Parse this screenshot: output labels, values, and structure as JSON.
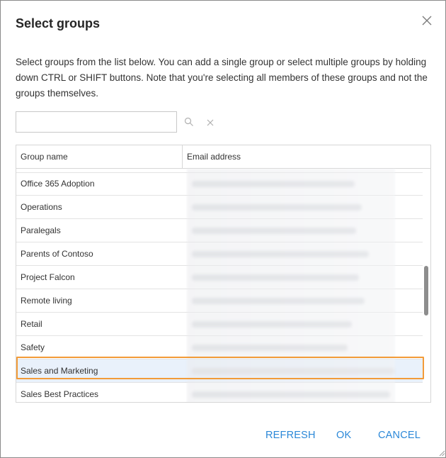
{
  "dialog": {
    "title": "Select groups",
    "description": "Select groups from the list below. You can add a single group or select multiple groups by holding down CTRL or SHIFT buttons. Note that you're selecting all members of these groups and not the groups themselves.",
    "close_icon": "close-icon"
  },
  "search": {
    "value": "",
    "placeholder": "",
    "search_icon": "search-icon",
    "clear_icon": "clear-icon"
  },
  "table": {
    "columns": [
      "Group name",
      "Email address"
    ],
    "rows": [
      {
        "name": "Office 365 Adoption",
        "selected": false
      },
      {
        "name": "Operations",
        "selected": false
      },
      {
        "name": "Paralegals",
        "selected": false
      },
      {
        "name": "Parents of Contoso",
        "selected": false
      },
      {
        "name": "Project Falcon",
        "selected": false
      },
      {
        "name": "Remote living",
        "selected": false
      },
      {
        "name": "Retail",
        "selected": false
      },
      {
        "name": "Safety",
        "selected": false
      },
      {
        "name": "Sales and Marketing",
        "selected": true
      },
      {
        "name": "Sales Best Practices",
        "selected": false
      }
    ]
  },
  "buttons": {
    "refresh": "REFRESH",
    "ok": "OK",
    "cancel": "CANCEL"
  },
  "colors": {
    "accent": "#2b88d8",
    "highlight_border": "#f29b38",
    "selected_row": "#e9f1fb"
  }
}
